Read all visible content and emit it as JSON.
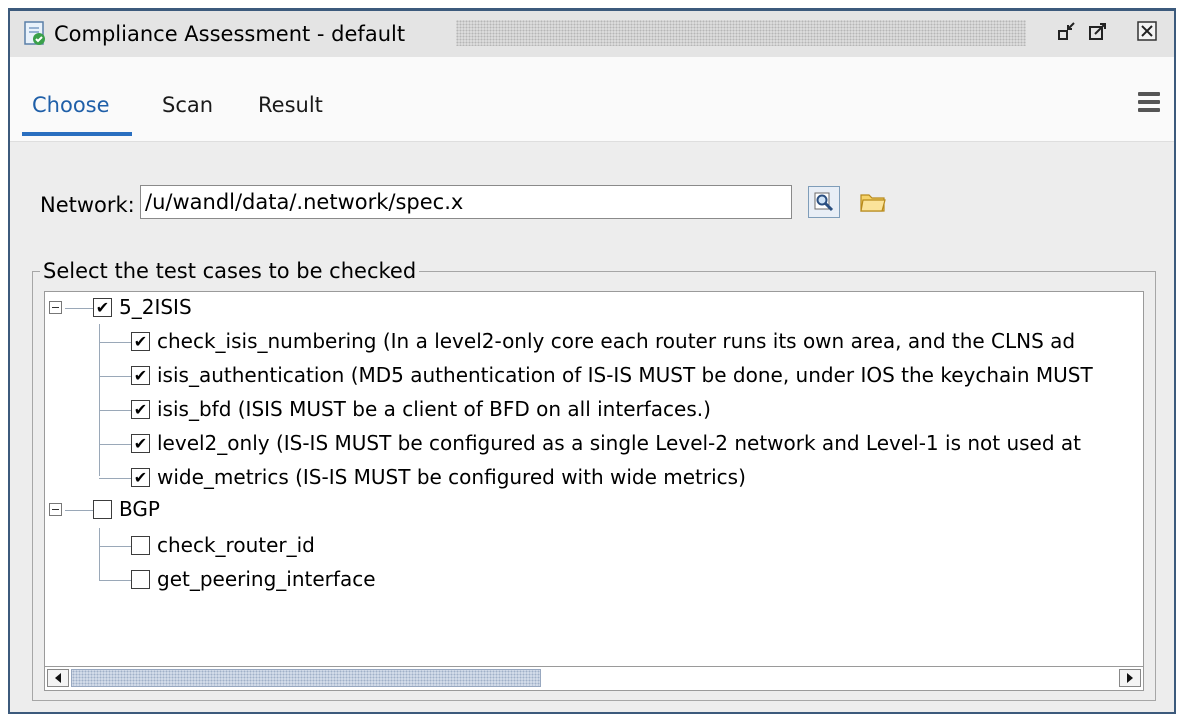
{
  "window": {
    "title": "Compliance Assessment - default",
    "icons": [
      "compliance-app-icon",
      "minimize-icon",
      "maximize-icon",
      "close-icon"
    ]
  },
  "tabs": [
    {
      "label": "Choose",
      "active": true
    },
    {
      "label": "Scan",
      "active": false
    },
    {
      "label": "Result",
      "active": false
    }
  ],
  "network": {
    "label": "Network:",
    "value": "/u/wandl/data/.network/spec.x"
  },
  "test_cases": {
    "legend": "Select the test cases to be checked",
    "groups": [
      {
        "name": "5_2ISIS",
        "checked": true,
        "items": [
          {
            "label": "check_isis_numbering   (In a level2-only core each router runs its own area, and the CLNS ad",
            "checked": true
          },
          {
            "label": "isis_authentication   (MD5 authentication of IS-IS MUST be done, under IOS the keychain MUST",
            "checked": true
          },
          {
            "label": "isis_bfd   (ISIS MUST be a client of BFD on all interfaces.)",
            "checked": true
          },
          {
            "label": "level2_only   (IS-IS MUST be configured as a single Level-2 network and Level-1 is not used at",
            "checked": true
          },
          {
            "label": "wide_metrics   (IS-IS MUST be configured with wide metrics)",
            "checked": true
          }
        ]
      },
      {
        "name": "BGP",
        "checked": false,
        "items": [
          {
            "label": "check_router_id",
            "checked": false
          },
          {
            "label": "get_peering_interface",
            "checked": false
          }
        ]
      }
    ]
  },
  "colors": {
    "accent": "#2a6fc0",
    "window_border": "#3c5a7c",
    "panel_bg": "#ededed"
  }
}
